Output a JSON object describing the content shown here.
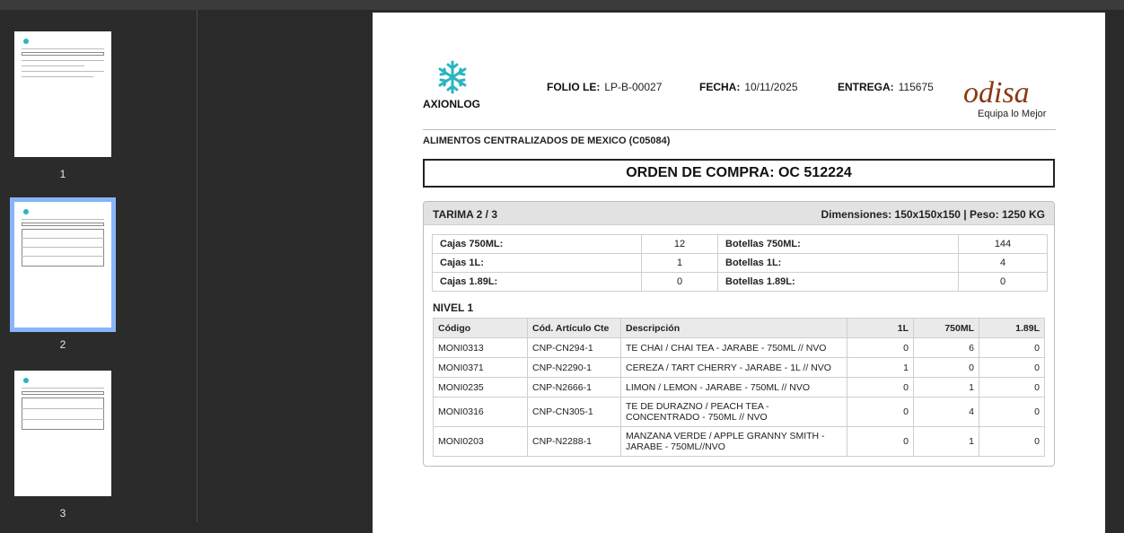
{
  "thumbnails": [
    {
      "number": "1"
    },
    {
      "number": "2",
      "selected": true
    },
    {
      "number": "3"
    }
  ],
  "header": {
    "company_logo": "AXIONLOG",
    "folio_label": "FOLIO LE:",
    "folio_value": "LP-B-00027",
    "fecha_label": "FECHA:",
    "fecha_value": "10/11/2025",
    "entrega_label": "ENTREGA:",
    "entrega_value": "115675",
    "brand_logo": "odisa",
    "brand_tagline": "Equipa lo Mejor"
  },
  "cliente": "ALIMENTOS CENTRALIZADOS DE MEXICO (C05084)",
  "orden": "ORDEN DE COMPRA: OC 512224",
  "tarima": {
    "title": "TARIMA 2 / 3",
    "dimensiones": "Dimensiones: 150x150x150 | Peso: 1250 KG",
    "cajas": [
      {
        "label": "Cajas 750ML:",
        "value": "12",
        "label2": "Botellas 750ML:",
        "value2": "144"
      },
      {
        "label": "Cajas 1L:",
        "value": "1",
        "label2": "Botellas 1L:",
        "value2": "4"
      },
      {
        "label": "Cajas 1.89L:",
        "value": "0",
        "label2": "Botellas 1.89L:",
        "value2": "0"
      }
    ],
    "nivel": "NIVEL 1",
    "columns": [
      "Código",
      "Cód. Artículo Cte",
      "Descripción",
      "1L",
      "750ML",
      "1.89L"
    ],
    "rows": [
      {
        "codigo": "MONI0313",
        "articulo": "CNP-CN294-1",
        "descripcion": "TE CHAI / CHAI TEA - JARABE - 750ML // NVO",
        "l1": "0",
        "ml750": "6",
        "l189": "0"
      },
      {
        "codigo": "MONI0371",
        "articulo": "CNP-N2290-1",
        "descripcion": "CEREZA / TART CHERRY - JARABE - 1L // NVO",
        "l1": "1",
        "ml750": "0",
        "l189": "0"
      },
      {
        "codigo": "MONI0235",
        "articulo": "CNP-N2666-1",
        "descripcion": "LIMON / LEMON - JARABE - 750ML // NVO",
        "l1": "0",
        "ml750": "1",
        "l189": "0"
      },
      {
        "codigo": "MONI0316",
        "articulo": "CNP-CN305-1",
        "descripcion": "TE DE DURAZNO / PEACH TEA - CONCENTRADO - 750ML // NVO",
        "l1": "0",
        "ml750": "4",
        "l189": "0"
      },
      {
        "codigo": "MONI0203",
        "articulo": "CNP-N2288-1",
        "descripcion": "MANZANA VERDE / APPLE GRANNY SMITH - JARABE - 750ML//NVO",
        "l1": "0",
        "ml750": "1",
        "l189": "0"
      }
    ]
  },
  "colors": {
    "accent": "#2bb5c0",
    "brand": "#8a3a12",
    "selection": "#8ab4f8"
  }
}
